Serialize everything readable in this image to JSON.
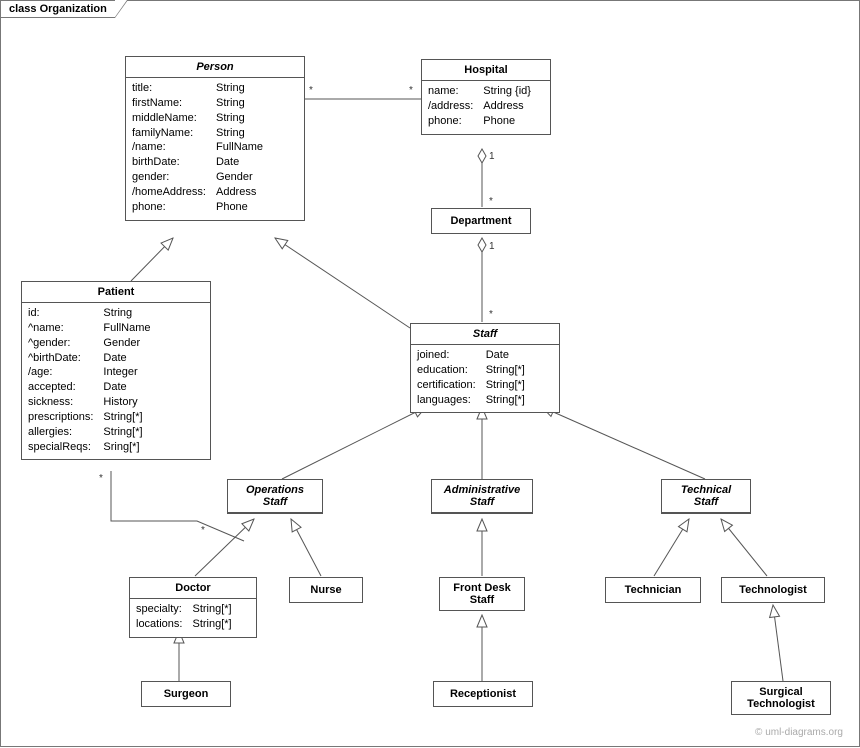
{
  "frame": {
    "title": "class Organization"
  },
  "watermark": "© uml-diagrams.org",
  "classes": {
    "person": {
      "name": "Person",
      "attrNames": "title:\nfirstName:\nmiddleName:\nfamilyName:\n/name:\nbirthDate:\ngender:\n/homeAddress:\nphone:",
      "attrTypes": "String\nString\nString\nString\nFullName\nDate\nGender\nAddress\nPhone"
    },
    "hospital": {
      "name": "Hospital",
      "attrNames": "name:\n/address:\nphone:",
      "attrTypes": "String {id}\nAddress\nPhone"
    },
    "department": {
      "name": "Department"
    },
    "patient": {
      "name": "Patient",
      "attrNames": "id:\n^name:\n^gender:\n^birthDate:\n/age:\naccepted:\nsickness:\nprescriptions:\nallergies:\nspecialReqs:",
      "attrTypes": "String\nFullName\nGender\nDate\nInteger\nDate\nHistory\nString[*]\nString[*]\nSring[*]"
    },
    "staff": {
      "name": "Staff",
      "attrNames": "joined:\neducation:\ncertification:\nlanguages:",
      "attrTypes": "Date\nString[*]\nString[*]\nString[*]"
    },
    "opstaff": {
      "name": "Operations\nStaff"
    },
    "adminstaff": {
      "name": "Administrative\nStaff"
    },
    "techstaff": {
      "name": "Technical\nStaff"
    },
    "doctor": {
      "name": "Doctor",
      "attrNames": "specialty:\nlocations:",
      "attrTypes": "String[*]\nString[*]"
    },
    "nurse": {
      "name": "Nurse"
    },
    "frontdesk": {
      "name": "Front Desk\nStaff"
    },
    "receptionist": {
      "name": "Receptionist"
    },
    "technician": {
      "name": "Technician"
    },
    "technologist": {
      "name": "Technologist"
    },
    "surgtech": {
      "name": "Surgical\nTechnologist"
    },
    "surgeon": {
      "name": "Surgeon"
    }
  },
  "mults": {
    "ph1": "*",
    "ph2": "*",
    "hd1": "1",
    "hd2": "*",
    "ds1": "1",
    "ds2": "*",
    "po1": "*",
    "po2": "*"
  }
}
